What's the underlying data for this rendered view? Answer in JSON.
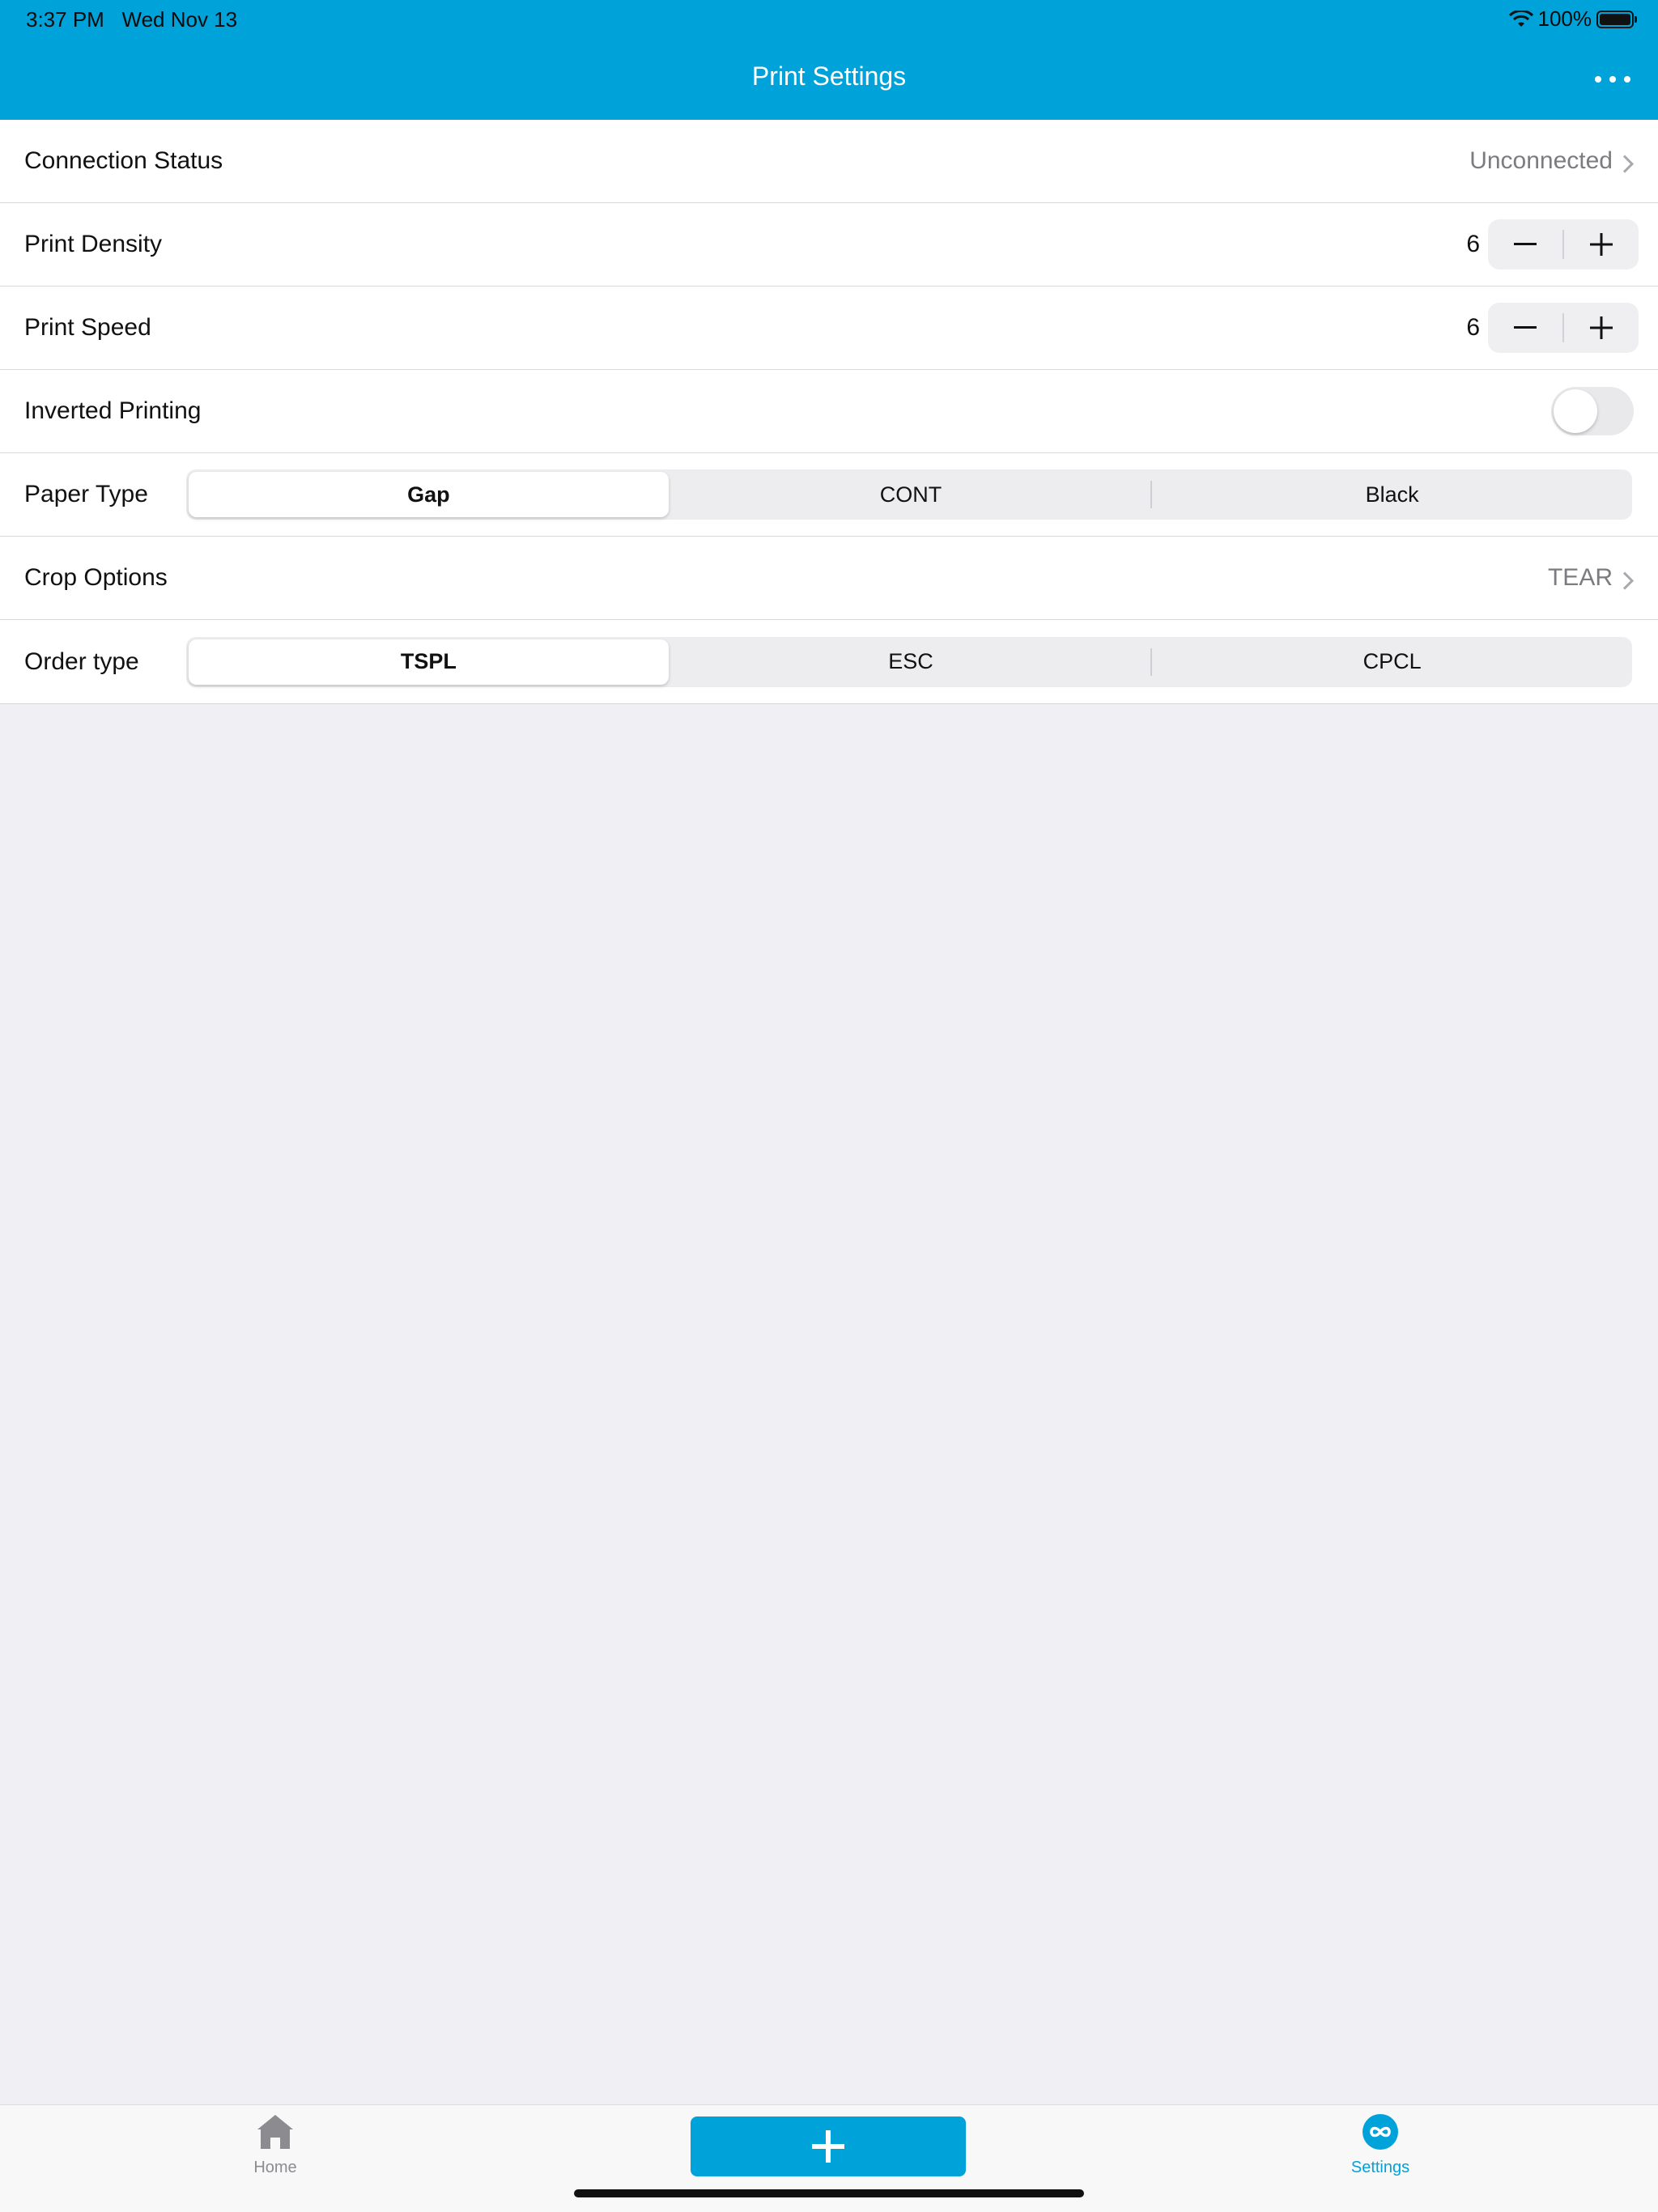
{
  "status_bar": {
    "time": "3:37 PM",
    "date": "Wed Nov 13",
    "battery": "100%"
  },
  "nav": {
    "title": "Print Settings",
    "more_icon": "ellipsis-icon"
  },
  "settings": {
    "connection": {
      "label": "Connection Status",
      "value": "Unconnected"
    },
    "density": {
      "label": "Print Density",
      "value": "6"
    },
    "speed": {
      "label": "Print Speed",
      "value": "6"
    },
    "inverted": {
      "label": "Inverted Printing",
      "on": false
    },
    "paper_type": {
      "label": "Paper Type",
      "options": [
        "Gap",
        "CONT",
        "Black"
      ],
      "selected": "Gap"
    },
    "crop": {
      "label": "Crop Options",
      "value": "TEAR"
    },
    "order_type": {
      "label": "Order type",
      "options": [
        "TSPL",
        "ESC",
        "CPCL"
      ],
      "selected": "TSPL"
    }
  },
  "tabbar": {
    "home_label": "Home",
    "settings_label": "Settings",
    "add_icon": "plus-icon"
  },
  "colors": {
    "accent": "#00a2da",
    "background": "#efeff4",
    "row": "#ffffff"
  }
}
